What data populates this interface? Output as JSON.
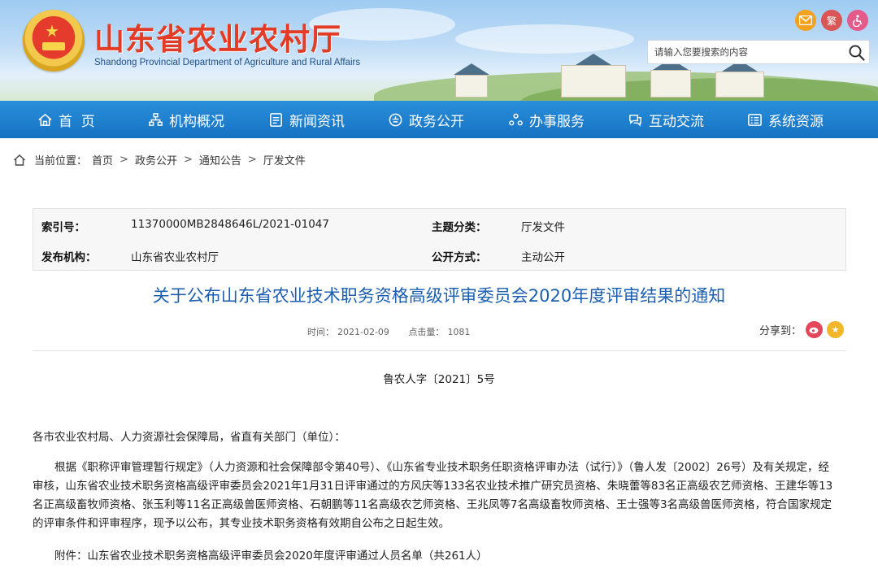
{
  "header": {
    "title": "山东省农业农村厅",
    "subtitle": "Shandong Provincial Department of Agriculture and Rural Affairs",
    "trad_label": "繁",
    "search_placeholder": "请输入您要搜索的内容"
  },
  "nav": {
    "items": [
      {
        "label": "首  页",
        "icon": "home-icon"
      },
      {
        "label": "机构概况",
        "icon": "org-icon"
      },
      {
        "label": "新闻资讯",
        "icon": "news-icon"
      },
      {
        "label": "政务公开",
        "icon": "gov-icon"
      },
      {
        "label": "办事服务",
        "icon": "service-icon"
      },
      {
        "label": "互动交流",
        "icon": "chat-icon"
      },
      {
        "label": "系统资源",
        "icon": "system-icon"
      }
    ]
  },
  "breadcrumb": {
    "prefix": "当前位置：",
    "items": [
      "首页",
      "政务公开",
      "通知公告",
      "厅发文件"
    ],
    "separator": ">"
  },
  "info": {
    "index_label": "索引号：",
    "index_value": "11370000MB2848646L/2021-01047",
    "topic_label": "主题分类：",
    "topic_value": "厅发文件",
    "publisher_label": "发布机构：",
    "publisher_value": "山东省农业农村厅",
    "mode_label": "公开方式：",
    "mode_value": "主动公开"
  },
  "article": {
    "title": "关于公布山东省农业技术职务资格高级评审委员会2020年度评审结果的通知",
    "time_label": "时间：",
    "time_value": "2021-02-09",
    "hits_label": "点击量：",
    "hits_value": "1081",
    "share_label": "分享到：",
    "doc_no": "鲁农人字〔2021〕5号",
    "salutation": "各市农业农村局、人力资源社会保障局，省直有关部门（单位）：",
    "paragraph": "根据《职称评审管理暂行规定》（人力资源和社会保障部令第40号）、《山东省专业技术职务任职资格评审办法（试行）》（鲁人发〔2002〕26号）及有关规定，经审核，山东省农业技术职务资格高级评审委员会2021年1月31日评审通过的方风庆等133名农业技术推广研究员资格、朱晓蕾等83名正高级农艺师资格、王建华等13名正高级畜牧师资格、张玉利等11名正高级兽医师资格、石朝鹏等11名高级农艺师资格、王兆凤等7名高级畜牧师资格、王士强等3名高级兽医师资格，符合国家规定的评审条件和评审程序，现予以公布，其专业技术职务资格有效期自公布之日起生效。",
    "attachment": "附件：山东省农业技术职务资格高级评审委员会2020年度评审通过人员名单（共261人）"
  },
  "colors": {
    "nav_blue": "#1672c2",
    "title_red": "#e23c27",
    "article_title_blue": "#1c5fb0"
  }
}
